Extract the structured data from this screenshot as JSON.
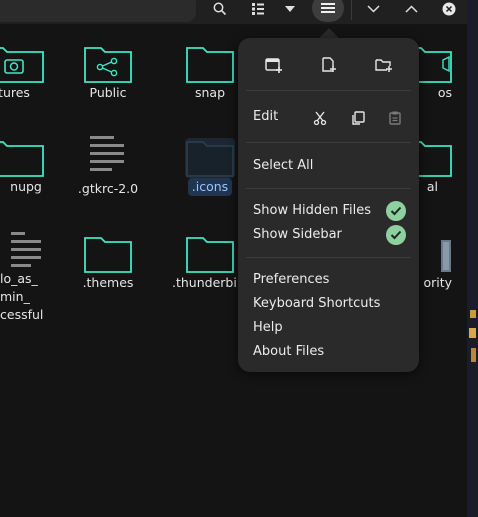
{
  "header": {
    "search_icon": "search-icon",
    "view_icon": "list-view-icon",
    "view_dropdown_icon": "chevron-down-icon",
    "menu_icon": "hamburger-menu-icon",
    "minimize_icon": "chevron-down-icon",
    "maximize_icon": "chevron-up-icon",
    "close_icon": "close-icon"
  },
  "files": [
    {
      "label": "tures",
      "icon": "folder-pictures-icon"
    },
    {
      "label": "Public",
      "icon": "folder-share-icon"
    },
    {
      "label": "snap",
      "icon": "folder-icon"
    },
    {
      "label": "os",
      "icon": "folder-videos-icon"
    },
    {
      "label": "nupg",
      "icon": "folder-icon"
    },
    {
      "label": ".gtkrc-2.0",
      "icon": "text-file-icon"
    },
    {
      "label": ".icons",
      "icon": "folder-icon"
    },
    {
      "label": "al",
      "icon": "folder-icon"
    },
    {
      "label": "lo_as_\nmin_\ncessful",
      "icon": "text-file-icon"
    },
    {
      "label": ".themes",
      "icon": "folder-icon"
    },
    {
      "label": ".thunderbi",
      "icon": "folder-icon"
    },
    {
      "label": "ority",
      "icon": "file-icon"
    }
  ],
  "menu": {
    "new_window_icon": "new-window-icon",
    "new_document_icon": "new-document-icon",
    "new_folder_icon": "new-folder-icon",
    "edit_label": "Edit",
    "cut_icon": "cut-icon",
    "copy_icon": "copy-icon",
    "paste_icon": "paste-icon",
    "select_all": "Select All",
    "show_hidden_files": "Show Hidden Files",
    "show_hidden_files_checked": true,
    "show_sidebar": "Show Sidebar",
    "show_sidebar_checked": true,
    "preferences": "Preferences",
    "keyboard_shortcuts": "Keyboard Shortcuts",
    "help": "Help",
    "about": "About Files"
  },
  "colors": {
    "accent_folder": "#3ee6c4",
    "check_green": "#8fd0a0",
    "selection": "#1f3550"
  }
}
